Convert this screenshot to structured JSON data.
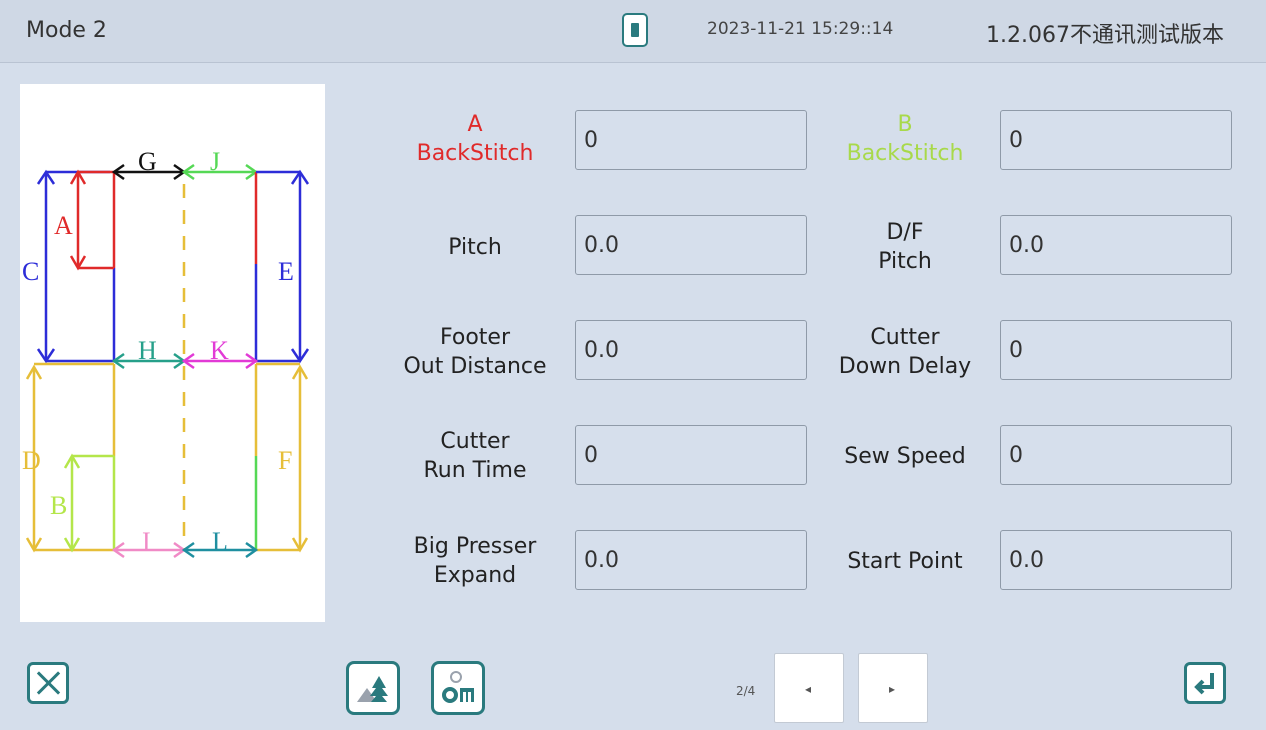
{
  "header": {
    "mode_title": "Mode 2",
    "usb_icon": "usb-drive-icon",
    "datetime": "2023-11-21 15:29::14",
    "version": "1.2.067不通讯测试版本"
  },
  "diagram": {
    "labels": {
      "A": "A",
      "B": "B",
      "C": "C",
      "D": "D",
      "E": "E",
      "F": "F",
      "G": "G",
      "H": "H",
      "I": "I",
      "J": "J",
      "K": "K",
      "L": "L"
    },
    "colors": {
      "red": "#e02a2a",
      "blue": "#2d2dd8",
      "black": "#111111",
      "green": "#55d855",
      "teal": "#26a08a",
      "magenta": "#e23ad6",
      "yellow": "#e6be38",
      "lime": "#b4e64a",
      "pink": "#f08ac6",
      "cyan_teal": "#1f8fa0"
    }
  },
  "params": {
    "a_backstitch": {
      "line1": "A",
      "line2": "BackStitch",
      "value": "0"
    },
    "b_backstitch": {
      "line1": "B",
      "line2": "BackStitch",
      "value": "0"
    },
    "pitch": {
      "label": "Pitch",
      "value": "0.0"
    },
    "df_pitch": {
      "line1": "D/F",
      "line2": "Pitch",
      "value": "0.0"
    },
    "footer_out": {
      "line1": "Footer",
      "line2": "Out Distance",
      "value": "0.0"
    },
    "cutter_down": {
      "line1": "Cutter",
      "line2": "Down Delay",
      "value": "0"
    },
    "cutter_run": {
      "line1": "Cutter",
      "line2": "Run Time",
      "value": "0"
    },
    "sew_speed": {
      "label": "Sew Speed",
      "value": "0"
    },
    "big_presser": {
      "line1": "Big Presser",
      "line2": "Expand",
      "value": "0.0"
    },
    "start_point": {
      "label": "Start Point",
      "value": "0.0"
    }
  },
  "footer": {
    "close_icon": "close-icon",
    "image_icon": "pattern-image-icon",
    "settings_icon": "machine-settings-icon",
    "page_indicator": "2/4",
    "prev_arrow": "◂",
    "next_arrow": "▸",
    "enter_icon": "enter-return-icon"
  }
}
